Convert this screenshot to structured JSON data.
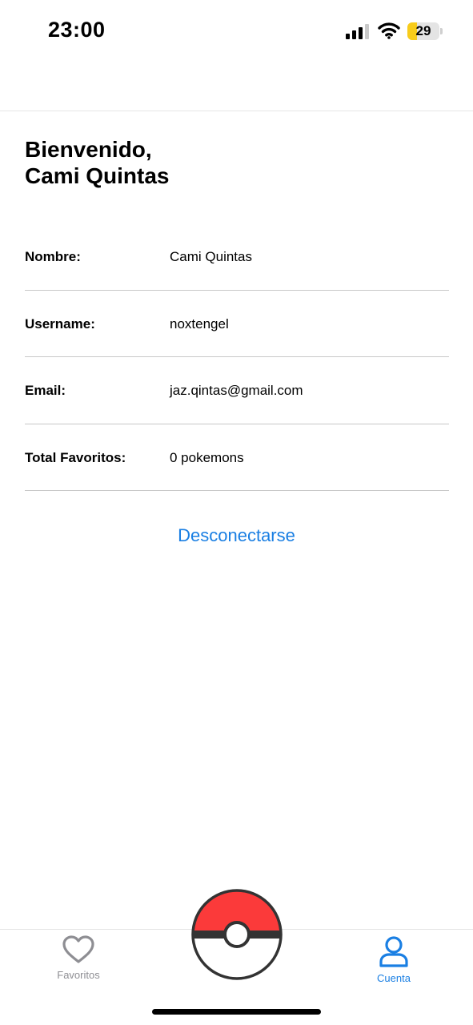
{
  "status_bar": {
    "time": "23:00",
    "battery_level": "29",
    "battery_color": "#f8cc1b"
  },
  "welcome": {
    "line1": "Bienvenido,",
    "line2": "Cami Quintas"
  },
  "info": [
    {
      "label": "Nombre:",
      "value": "Cami Quintas"
    },
    {
      "label": "Username:",
      "value": "noxtengel"
    },
    {
      "label": "Email:",
      "value": "jaz.qintas@gmail.com"
    },
    {
      "label": "Total Favoritos:",
      "value": "0 pokemons"
    }
  ],
  "logout_label": "Desconectarse",
  "tabs": {
    "favorites": {
      "label": "Favoritos",
      "icon": "heart-icon"
    },
    "center": {
      "icon": "pokeball-icon"
    },
    "account": {
      "label": "Cuenta",
      "icon": "person-icon",
      "selected": true
    }
  },
  "colors": {
    "accent": "#1a7fe3",
    "inactive": "#8e8e93",
    "pokeball_red": "#fb3a3a"
  }
}
